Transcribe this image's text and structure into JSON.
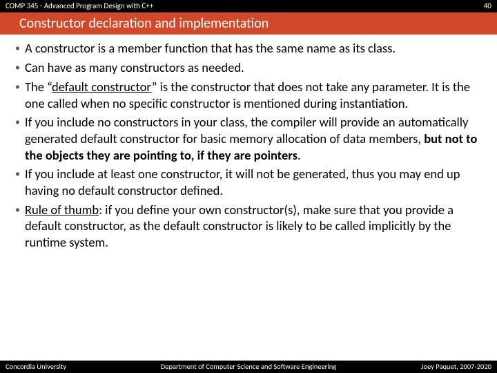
{
  "header": {
    "course": "COMP 345 - Advanced Program Design with C++",
    "slide_number": "40"
  },
  "title": "Constructor declaration and implementation",
  "bullets": {
    "b1": "A constructor is a member function that has the same name as its class.",
    "b2": "Can have as many constructors as needed.",
    "b3a": "The “",
    "b3u": "default constructor",
    "b3b": "” is the constructor that does not take any parameter. It is the one called when no specific constructor is mentioned during instantiation.",
    "b4a": "If you include no constructors in your class, the compiler will provide an automatically generated default constructor for basic memory allocation of data members, ",
    "b4bold": "but not to the objects they are pointing to, if they are pointers",
    "b4b": ".",
    "b5": "If you include at least one constructor, it will not be generated, thus you may end up having no default constructor defined.",
    "b6u": "Rule of thumb",
    "b6b": ": if you define your own constructor(s), make sure that you provide a default constructor, as the default constructor is likely to be called implicitly by the runtime system."
  },
  "footer": {
    "left": "Concordia University",
    "center": "Department of Computer Science and Software Engineering",
    "right": "Joey Paquet, 2007-2020"
  }
}
